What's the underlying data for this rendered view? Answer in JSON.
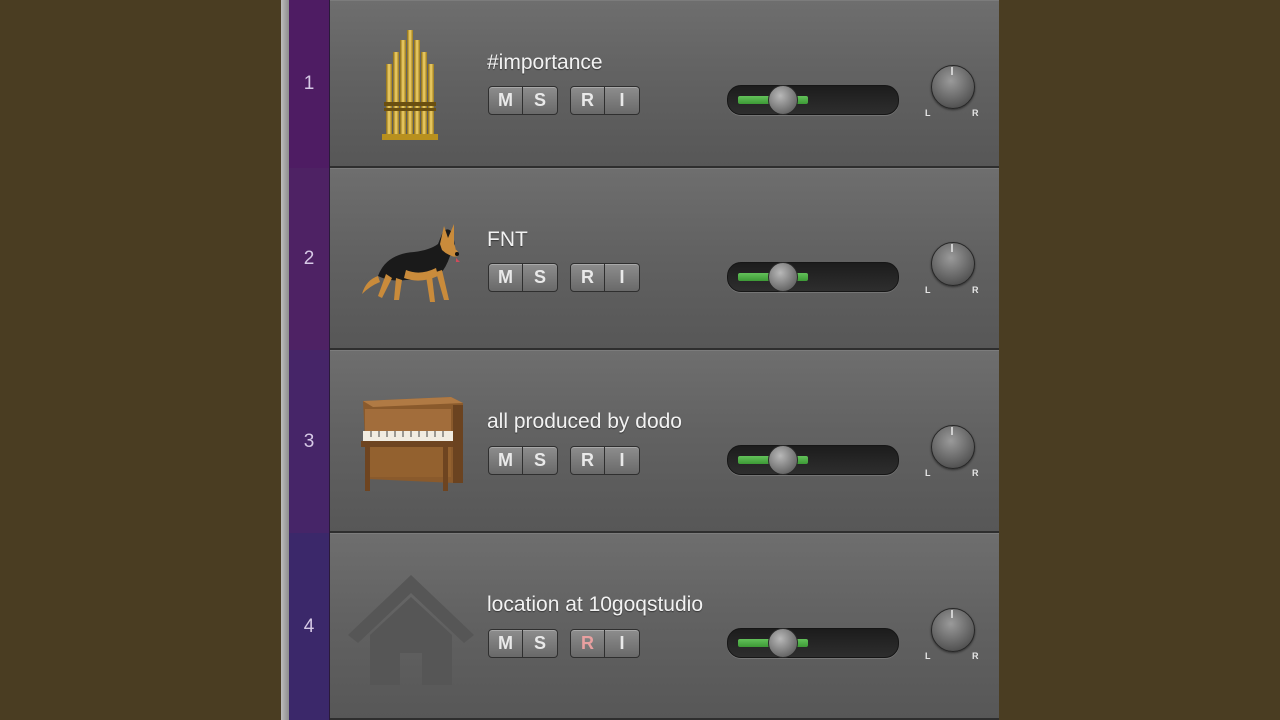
{
  "tracks": [
    {
      "number": "1",
      "name": "#importance",
      "icon": "pipe-organ-icon",
      "color": "#4e1c63",
      "mute": "M",
      "solo": "S",
      "record": "R",
      "input": "I",
      "record_armed": false,
      "volume": 0.45
    },
    {
      "number": "2",
      "name": "FNT",
      "icon": "dog-icon",
      "color": "#4e2264",
      "mute": "M",
      "solo": "S",
      "record": "R",
      "input": "I",
      "record_armed": false,
      "volume": 0.45
    },
    {
      "number": "3",
      "name": "all produced by dodo",
      "icon": "piano-icon",
      "color": "#462568",
      "mute": "M",
      "solo": "S",
      "record": "R",
      "input": "I",
      "record_armed": false,
      "volume": 0.45
    },
    {
      "number": "4",
      "name": "location at 10goqstudio",
      "icon": "home-icon",
      "color": "#3b286a",
      "mute": "M",
      "solo": "S",
      "record": "R",
      "input": "I",
      "record_armed": true,
      "volume": 0.45
    }
  ],
  "pan": {
    "left_label": "L",
    "right_label": "R"
  }
}
